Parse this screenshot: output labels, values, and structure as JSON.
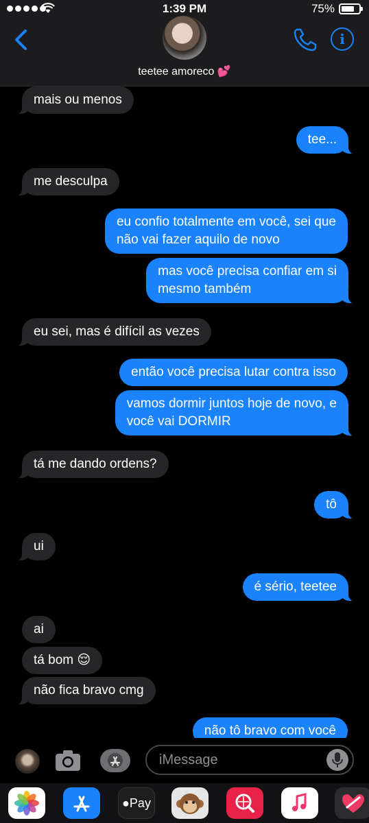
{
  "status_bar": {
    "time": "1:39 PM",
    "battery_percent": "75%",
    "battery_level": 0.75,
    "signal_bars": 5
  },
  "header": {
    "contact_name": "teetee amoreco",
    "contact_emoji": "💕"
  },
  "messages": [
    {
      "dir": "in",
      "text": "mais ou menos"
    },
    {
      "dir": "out",
      "text": "tee..."
    },
    {
      "dir": "in",
      "text": "me desculpa"
    },
    {
      "dir": "out",
      "lines": [
        "eu confio totalmente em você, sei que",
        "não vai fazer aquilo de novo"
      ]
    },
    {
      "dir": "out",
      "lines": [
        "mas você precisa confiar em si",
        "mesmo também"
      ]
    },
    {
      "dir": "in",
      "text": "eu sei, mas é difícil as vezes"
    },
    {
      "dir": "out",
      "text": "então você precisa lutar contra isso"
    },
    {
      "dir": "out",
      "lines": [
        "vamos dormir juntos hoje de novo, e",
        "você vai DORMIR"
      ]
    },
    {
      "dir": "in",
      "text": "tá me dando ordens?"
    },
    {
      "dir": "out",
      "text": "tô"
    },
    {
      "dir": "in",
      "text": "ui"
    },
    {
      "dir": "out",
      "text": "é sério, teetee"
    },
    {
      "dir": "in",
      "text": "ai"
    },
    {
      "dir": "in",
      "text": "tá bom 😌"
    },
    {
      "dir": "in",
      "text": "não fica bravo cmg"
    },
    {
      "dir": "out",
      "text": "não tô bravo com você"
    }
  ],
  "input": {
    "placeholder": "iMessage"
  },
  "app_drawer": {
    "apps": [
      "photos-app",
      "app-store-app",
      "apple-pay-app",
      "animoji-app",
      "search-images-app",
      "music-app",
      "digital-touch-app"
    ],
    "pay_label": "Pay"
  },
  "colors": {
    "outgoing": "#1a82fb",
    "incoming": "#262628",
    "background": "#000000",
    "accent": "#1a82fb"
  }
}
